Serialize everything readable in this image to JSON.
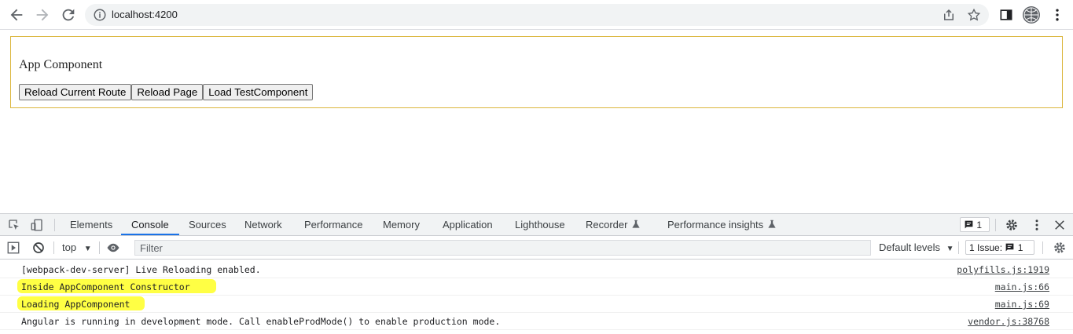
{
  "browser": {
    "url": "localhost:4200"
  },
  "app": {
    "title": "App Component",
    "buttons": [
      "Reload Current Route",
      "Reload Page",
      "Load TestComponent"
    ]
  },
  "devtools": {
    "tabs": [
      "Elements",
      "Console",
      "Sources",
      "Network",
      "Performance",
      "Memory",
      "Application",
      "Lighthouse",
      "Recorder",
      "Performance insights"
    ],
    "active_tab": "Console",
    "messages_badge": "1",
    "context": "top",
    "filter_placeholder": "Filter",
    "levels": "Default levels",
    "issues": "1 Issue:",
    "issues_count": "1",
    "console": [
      {
        "text": "[webpack-dev-server] Live Reloading enabled.",
        "source": "polyfills.js:1919",
        "highlight": false
      },
      {
        "text": "Inside AppComponent Constructor",
        "source": "main.js:66",
        "highlight": true
      },
      {
        "text": "Loading AppComponent",
        "source": "main.js:69",
        "highlight": true
      },
      {
        "text": "Angular is running in development mode. Call enableProdMode() to enable production mode.",
        "source": "vendor.js:38768",
        "highlight": false
      }
    ],
    "highlight_color": "#ffff44",
    "accent": "#1a73e8"
  },
  "icons": [
    "back-icon",
    "forward-icon",
    "reload-icon",
    "info-icon",
    "share-icon",
    "star-icon",
    "sidebar-icon",
    "inspect-icon",
    "device-icon",
    "message-icon",
    "gear-icon",
    "kebab-icon",
    "close-icon",
    "flask-icon",
    "play-icon",
    "block-icon",
    "eye-icon"
  ]
}
